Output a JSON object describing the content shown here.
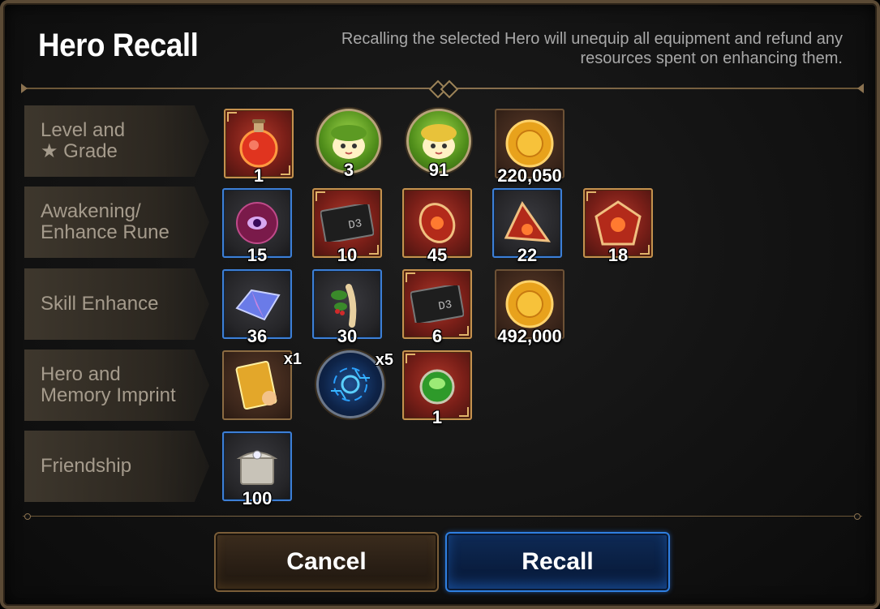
{
  "header": {
    "title": "Hero Recall",
    "description": "Recalling the selected Hero will unequip all equipment and refund any resources spent on enhancing them."
  },
  "rows": [
    {
      "label": "Level and\n★ Grade",
      "items": [
        {
          "icon": "red-potion-icon",
          "frame": "red",
          "qty": "1"
        },
        {
          "icon": "green-fairy-hero-icon",
          "frame": "circle-green",
          "qty": "3"
        },
        {
          "icon": "yellow-fairy-hero-icon",
          "frame": "circle-green",
          "qty": "91"
        },
        {
          "icon": "gold-coin-icon",
          "frame": "brown",
          "qty": "220,050"
        }
      ]
    },
    {
      "label": "Awakening/\nEnhance Rune",
      "items": [
        {
          "icon": "purple-eye-orb-icon",
          "frame": "blue",
          "qty": "15"
        },
        {
          "icon": "black-card-icon",
          "frame": "red",
          "qty": "10"
        },
        {
          "icon": "red-oval-rune-icon",
          "frame": "red",
          "qty": "45"
        },
        {
          "icon": "red-triangle-rune-icon",
          "frame": "blue",
          "qty": "22"
        },
        {
          "icon": "red-pentagon-rune-icon",
          "frame": "red",
          "qty": "18"
        }
      ]
    },
    {
      "label": "Skill Enhance",
      "items": [
        {
          "icon": "molagora-crystal-icon",
          "frame": "blue",
          "qty": "36"
        },
        {
          "icon": "root-herb-icon",
          "frame": "blue",
          "qty": "30"
        },
        {
          "icon": "black-card-icon",
          "frame": "red",
          "qty": "6"
        },
        {
          "icon": "gold-coin-icon",
          "frame": "brown",
          "qty": "492,000"
        }
      ]
    },
    {
      "label": "Hero and\nMemory Imprint",
      "items": [
        {
          "icon": "golden-book-icon",
          "frame": "brown",
          "qty": "",
          "mult": "x1"
        },
        {
          "icon": "blue-memory-rune-icon",
          "frame": "circle-navy",
          "qty": "",
          "mult": "x5"
        },
        {
          "icon": "green-gem-icon",
          "frame": "red",
          "qty": "1"
        }
      ]
    },
    {
      "label": "Friendship",
      "items": [
        {
          "icon": "silver-chest-icon",
          "frame": "blue",
          "qty": "100"
        }
      ]
    }
  ],
  "buttons": {
    "cancel": "Cancel",
    "recall": "Recall"
  },
  "colors": {
    "accent_gold": "#c5914e",
    "accent_blue": "#2f7fe0",
    "label_text": "#a59b8c"
  }
}
